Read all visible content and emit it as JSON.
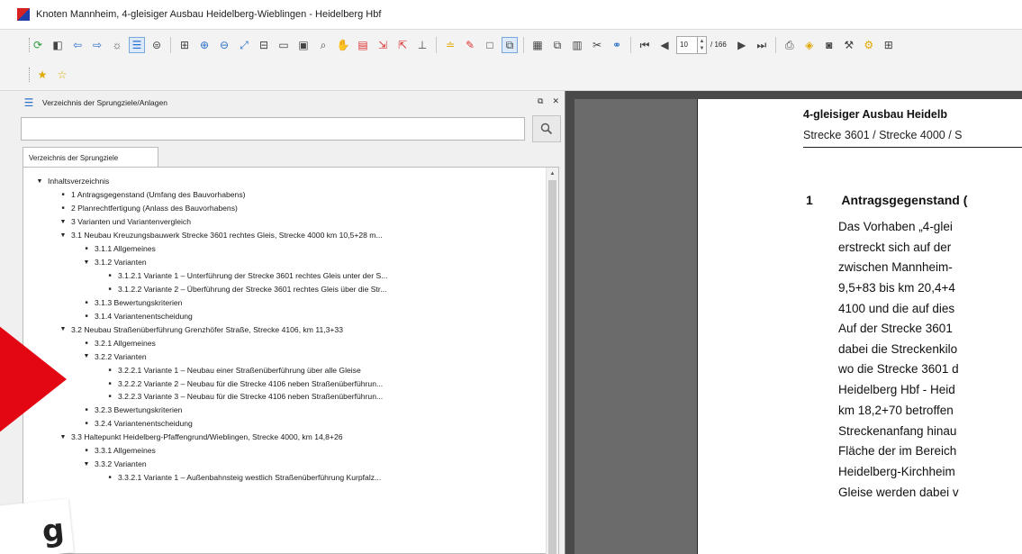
{
  "window": {
    "title": "Knoten Mannheim, 4-gleisiger Ausbau Heidelberg-Wieblingen - Heidelberg Hbf"
  },
  "toolbar": {
    "page_current": "10",
    "page_total": "/ 166"
  },
  "panel": {
    "title": "Verzeichnis der Sprungziele/Anlagen",
    "search_value": "",
    "tab_label": "Verzeichnis der Sprungziele",
    "tree": [
      {
        "level": 0,
        "marker": "expanded",
        "label": "Inhaltsverzeichnis"
      },
      {
        "level": 1,
        "marker": "leaf",
        "label": "1 Antragsgegenstand (Umfang des Bauvorhabens)"
      },
      {
        "level": 1,
        "marker": "leaf",
        "label": "2 Planrechtfertigung (Anlass des Bauvorhabens)"
      },
      {
        "level": 1,
        "marker": "expanded",
        "label": "3 Varianten und Variantenvergleich"
      },
      {
        "level": 2,
        "marker": "expanded",
        "label": "3.1 Neubau Kreuzungsbauwerk Strecke 3601 rechtes Gleis, Strecke 4000 km 10,5+28 m..."
      },
      {
        "level": 3,
        "marker": "leaf",
        "label": "3.1.1 Allgemeines"
      },
      {
        "level": 3,
        "marker": "expanded",
        "label": "3.1.2 Varianten"
      },
      {
        "level": 4,
        "marker": "leaf",
        "label": "3.1.2.1 Variante 1 – Unterführung der Strecke 3601 rechtes Gleis unter der S..."
      },
      {
        "level": 4,
        "marker": "leaf",
        "label": "3.1.2.2 Variante 2 – Überführung der Strecke 3601 rechtes Gleis über die Str..."
      },
      {
        "level": 3,
        "marker": "leaf",
        "label": "3.1.3 Bewertungskriterien"
      },
      {
        "level": 3,
        "marker": "leaf",
        "label": "3.1.4 Variantenentscheidung"
      },
      {
        "level": 2,
        "marker": "expanded",
        "label": "3.2 Neubau Straßenüberführung Grenzhöfer Straße, Strecke 4106, km 11,3+33"
      },
      {
        "level": 3,
        "marker": "leaf",
        "label": "3.2.1 Allgemeines"
      },
      {
        "level": 3,
        "marker": "expanded",
        "label": "3.2.2 Varianten"
      },
      {
        "level": 4,
        "marker": "leaf",
        "label": "3.2.2.1 Variante 1 – Neubau einer Straßenüberführung über alle Gleise"
      },
      {
        "level": 4,
        "marker": "leaf",
        "label": "3.2.2.2 Variante 2 – Neubau für die Strecke 4106 neben Straßenüberführun..."
      },
      {
        "level": 4,
        "marker": "leaf",
        "label": "3.2.2.3 Variante 3 – Neubau für die Strecke 4106 neben Straßenüberführun..."
      },
      {
        "level": 3,
        "marker": "leaf",
        "label": "3.2.3 Bewertungskriterien"
      },
      {
        "level": 3,
        "marker": "leaf",
        "label": "3.2.4 Variantenentscheidung"
      },
      {
        "level": 2,
        "marker": "expanded",
        "label": "3.3 Haltepunkt Heidelberg-Pfaffengrund/Wieblingen, Strecke 4000, km 14,8+26"
      },
      {
        "level": 3,
        "marker": "leaf",
        "label": "3.3.1 Allgemeines"
      },
      {
        "level": 3,
        "marker": "expanded",
        "label": "3.3.2 Varianten"
      },
      {
        "level": 4,
        "marker": "leaf",
        "label": "3.3.2.1 Variante 1 – Außenbahnsteig westlich Straßenüberführung Kurpfalz..."
      }
    ]
  },
  "decor": {
    "label_glyph": "g"
  },
  "document": {
    "header": "4-gleisiger Ausbau Heidelb",
    "subheader": "Strecke 3601 / Strecke 4000 / S",
    "section_number": "1",
    "section_title": "Antragsgegenstand (",
    "para1": [
      "Das Vorhaben „4-glei",
      "erstreckt sich auf der",
      "zwischen Mannheim-",
      "9,5+83 bis km 20,4+4",
      "4100 und die auf dies"
    ],
    "para2": [
      "Auf der Strecke 3601",
      "dabei die Streckenkilo",
      "wo die Strecke 3601 d",
      "Heidelberg Hbf - Heid",
      "km 18,2+70 betroffen",
      "Streckenanfang hinau",
      "Fläche der im Bereich",
      "Heidelberg-Kirchheim",
      "Gleise werden dabei v"
    ]
  }
}
